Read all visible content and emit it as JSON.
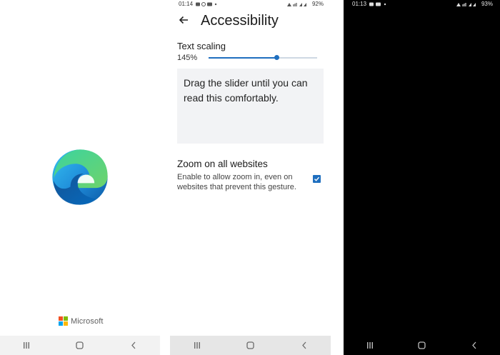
{
  "splash": {
    "brand_label": "Microsoft",
    "colors": {
      "ms_red": "#f25022",
      "ms_green": "#7fba00",
      "ms_blue": "#00a4ef",
      "ms_yellow": "#ffb900"
    }
  },
  "accessibility": {
    "status_time": "01:14",
    "status_battery": "92%",
    "back_icon": "arrow-left-icon",
    "title": "Accessibility",
    "text_scaling": {
      "label": "Text scaling",
      "value_label": "145%",
      "fraction": 0.63
    },
    "preview_text": "Drag the slider until you can read this comfortably.",
    "zoom": {
      "title": "Zoom on all websites",
      "description": "Enable to allow zoom in, even on websites that prevent this gesture.",
      "checked": true
    },
    "accent_color": "#1f6fbf"
  },
  "black_screen": {
    "status_time": "01:13",
    "status_battery": "93%"
  },
  "navbar": {
    "recents_icon": "recents-icon",
    "home_icon": "home-icon",
    "back_icon": "back-chevron-icon"
  }
}
